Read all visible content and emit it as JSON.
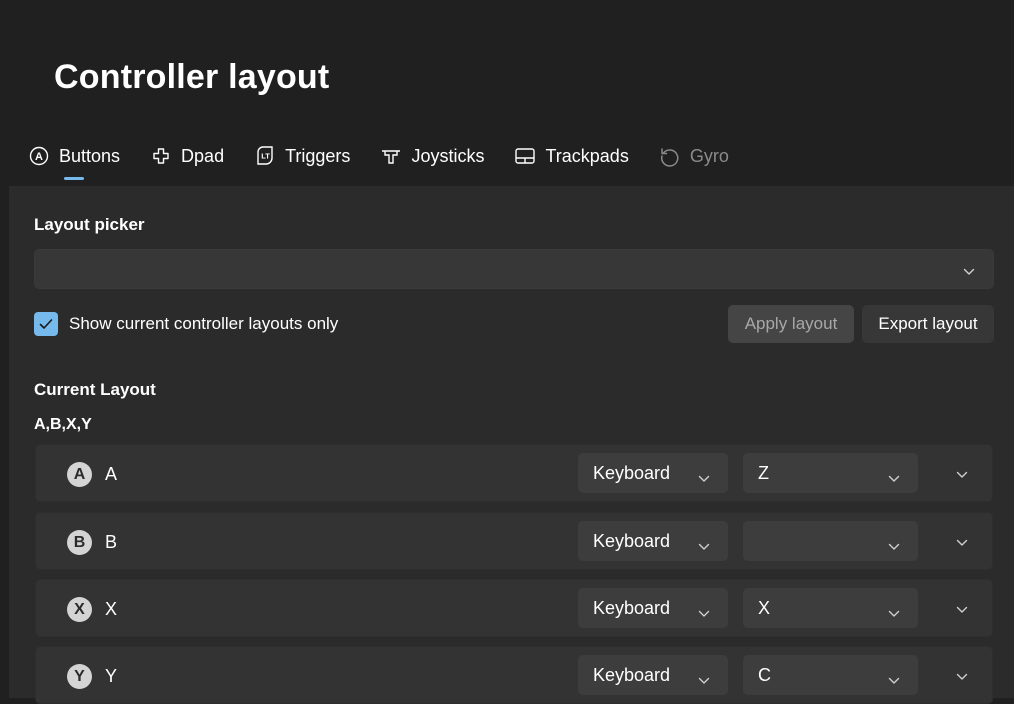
{
  "page": {
    "title": "Controller layout"
  },
  "tabs": [
    {
      "label": "Buttons",
      "icon": "a-circle-icon",
      "active": true
    },
    {
      "label": "Dpad",
      "icon": "dpad-icon"
    },
    {
      "label": "Triggers",
      "icon": "trigger-lt-icon"
    },
    {
      "label": "Joysticks",
      "icon": "joystick-icon"
    },
    {
      "label": "Trackpads",
      "icon": "trackpad-icon"
    },
    {
      "label": "Gyro",
      "icon": "gyro-icon",
      "disabled": true
    }
  ],
  "layout_picker": {
    "label": "Layout picker",
    "value": ""
  },
  "filter": {
    "label": "Show current controller layouts only",
    "checked": true
  },
  "actions": {
    "apply_label": "Apply layout",
    "export_label": "Export layout"
  },
  "current_layout": {
    "heading": "Current Layout",
    "group_label": "A,B,X,Y",
    "rows": [
      {
        "glyph": "A",
        "label": "A",
        "type": "Keyboard",
        "key": "Z"
      },
      {
        "glyph": "B",
        "label": "B",
        "type": "Keyboard",
        "key": ""
      },
      {
        "glyph": "X",
        "label": "X",
        "type": "Keyboard",
        "key": "X"
      },
      {
        "glyph": "Y",
        "label": "Y",
        "type": "Keyboard",
        "key": "C"
      }
    ]
  },
  "colors": {
    "accent": "#76b9ed",
    "background": "#202020",
    "panel": "#2b2b2b"
  }
}
